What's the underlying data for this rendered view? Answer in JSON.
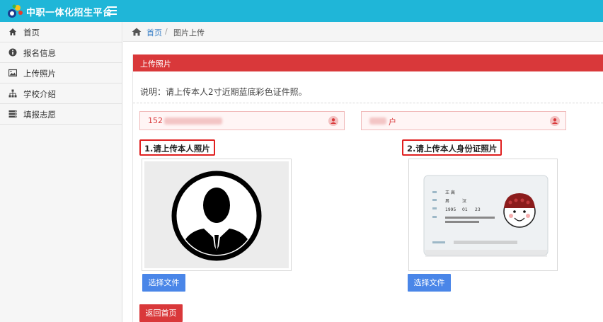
{
  "header": {
    "brand": "中职一体化招生平台"
  },
  "sidebar": {
    "items": [
      {
        "label": "首页",
        "icon": "home-icon"
      },
      {
        "label": "报名信息",
        "icon": "info-icon"
      },
      {
        "label": "上传照片",
        "icon": "image-icon"
      },
      {
        "label": "学校介绍",
        "icon": "sitemap-icon"
      },
      {
        "label": "填报志愿",
        "icon": "list-icon"
      }
    ]
  },
  "breadcrumb": {
    "home": "首页",
    "separator": "/",
    "current": "图片上传"
  },
  "panel": {
    "title": "上传照片",
    "notice": "说明：请上传本人2寸近期蓝底彩色证件照。"
  },
  "fields": {
    "left_value": "152",
    "right_value": "户"
  },
  "uploads": {
    "photo_label": "1.请上传本人照片",
    "id_label": "2.请上传本人身份证照片",
    "id_card_name": "王 高",
    "id_card_gender": "男",
    "id_card_nation": "汉",
    "id_card_year": "1995",
    "id_card_month": "01",
    "id_card_day": "23",
    "choose_file": "选择文件"
  },
  "back_button": "返回首页",
  "colors": {
    "topbar": "#1fb6d8",
    "panel_header": "#d9383a",
    "button_blue": "#4a86e8",
    "link": "#3a80c7"
  }
}
